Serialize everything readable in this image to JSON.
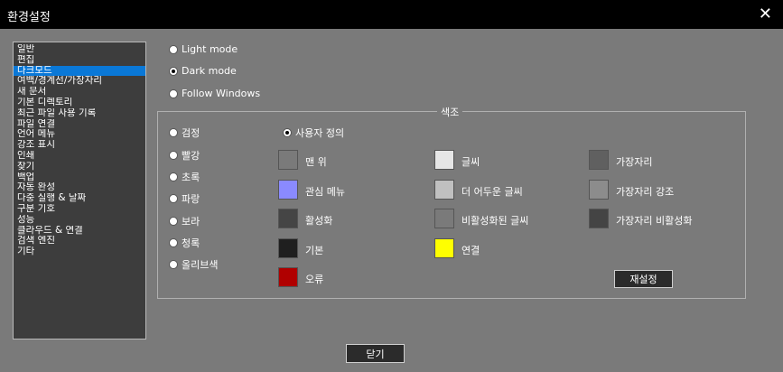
{
  "window": {
    "title": "환경설정",
    "close_glyph": "✕"
  },
  "sidebar": {
    "selected_index": 2,
    "items": [
      "일반",
      "편집",
      "다크모드",
      "여백/경계선/가장자리",
      "새 문서",
      "기본 디렉토리",
      "최근 파일 사용 기록",
      "파일 연결",
      "언어 메뉴",
      "강조 표시",
      "인쇄",
      "찾기",
      "백업",
      "자동 완성",
      "다중 실행 & 날짜",
      "구분 기호",
      "성능",
      "클라우드 & 연결",
      "검색 엔진",
      "기타"
    ]
  },
  "mode": {
    "options": [
      "Light mode",
      "Dark mode",
      "Follow Windows"
    ],
    "selected_index": 1
  },
  "tone": {
    "title": "색조",
    "options": [
      "검정",
      "빨강",
      "초록",
      "파랑",
      "보라",
      "청록",
      "올리브색"
    ],
    "custom": "사용자 정의",
    "selected": "custom"
  },
  "swatches": [
    {
      "label": "맨 위",
      "color": "#7a7a7a"
    },
    {
      "label": "관심 메뉴",
      "color": "#8a8aff"
    },
    {
      "label": "활성화",
      "color": "#454545"
    },
    {
      "label": "기본",
      "color": "#1f1f1f"
    },
    {
      "label": "오류",
      "color": "#b00000"
    },
    {
      "label": "글씨",
      "color": "#e6e6e6"
    },
    {
      "label": "더 어두운 글씨",
      "color": "#c0c0c0"
    },
    {
      "label": "비활성화된 글씨",
      "color": "#7a7a7a"
    },
    {
      "label": "연결",
      "color": "#ffff00"
    },
    {
      "label": "가장자리",
      "color": "#606060"
    },
    {
      "label": "가장자리 강조",
      "color": "#8c8c8c"
    },
    {
      "label": "가장자리 비활성화",
      "color": "#444444"
    }
  ],
  "buttons": {
    "reset": "재설정",
    "close": "닫기"
  }
}
